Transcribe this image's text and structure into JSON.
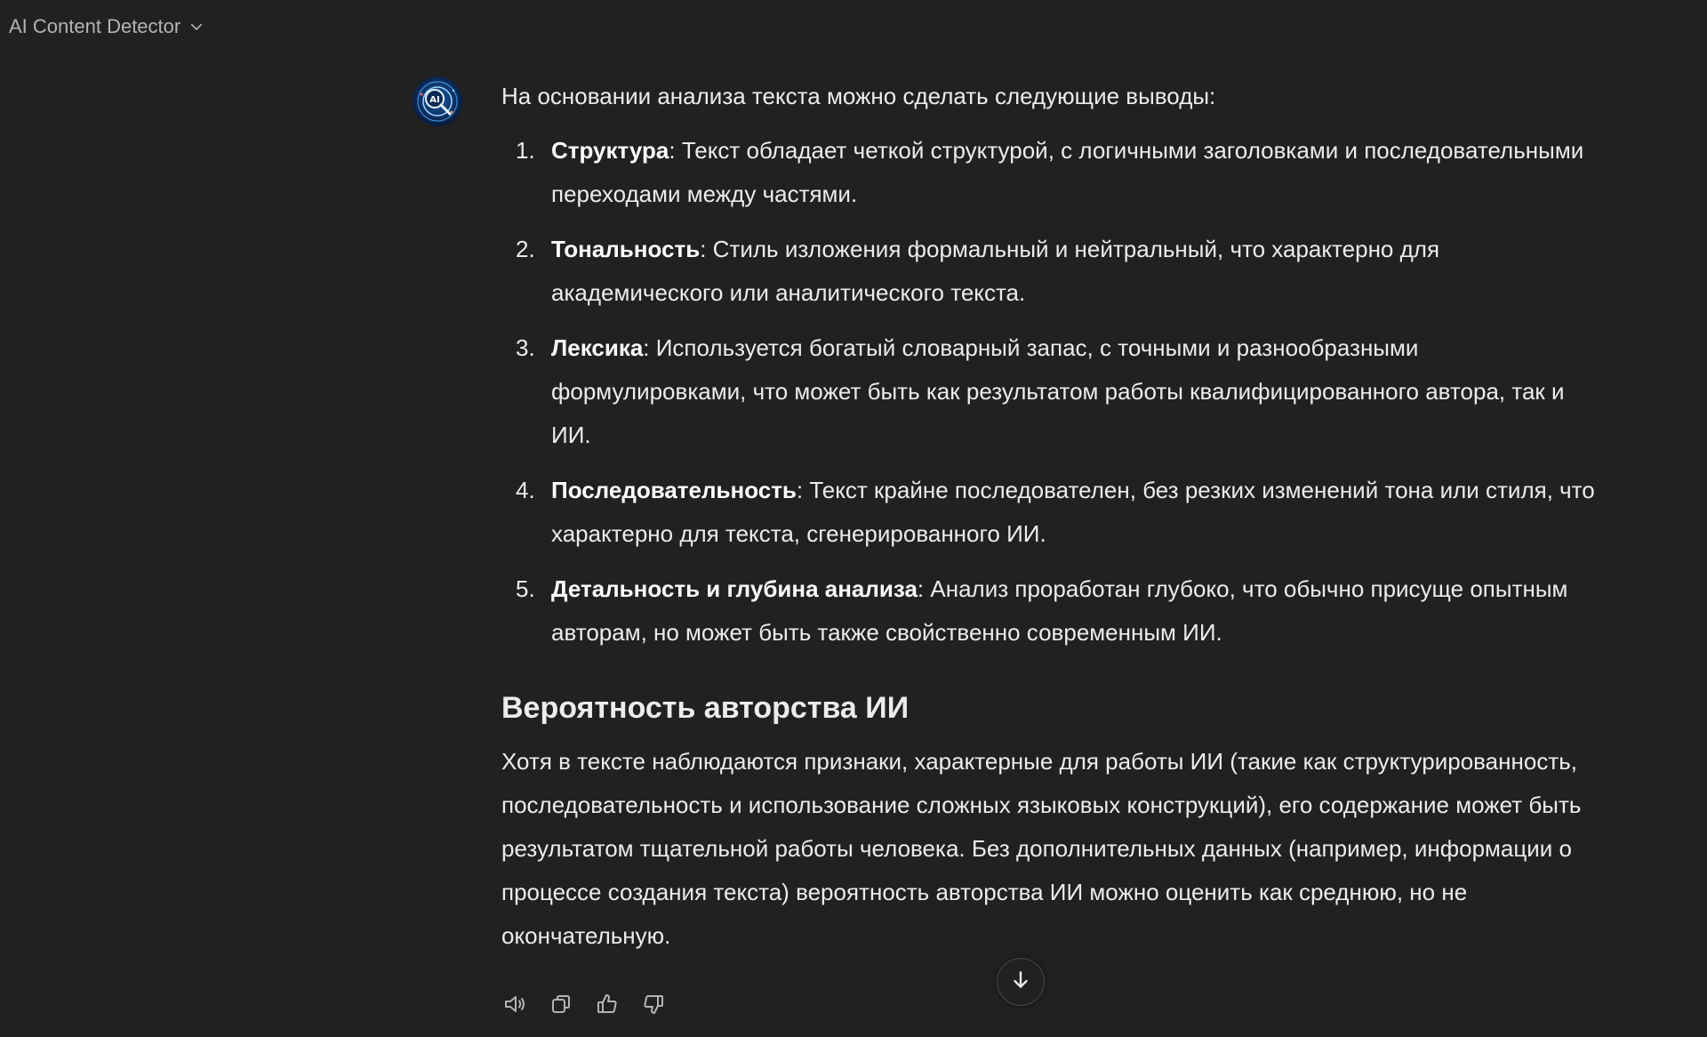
{
  "header": {
    "model_name": "AI Content Detector"
  },
  "message": {
    "avatar_text": "AI",
    "intro": "На основании анализа текста можно сделать следующие выводы:",
    "points": [
      {
        "number": "1.",
        "title": "Структура",
        "text": ": Текст обладает четкой структурой, с логичными заголовками и последовательными переходами между частями."
      },
      {
        "number": "2.",
        "title": "Тональность",
        "text": ": Стиль изложения формальный и нейтральный, что характерно для академического или аналитического текста."
      },
      {
        "number": "3.",
        "title": "Лексика",
        "text": ": Используется богатый словарный запас, с точными и разнообразными формулировками, что может быть как результатом работы квалифицированного автора, так и ИИ."
      },
      {
        "number": "4.",
        "title": "Последовательность",
        "text": ": Текст крайне последователен, без резких изменений тона или стиля, что характерно для текста, сгенерированного ИИ."
      },
      {
        "number": "5.",
        "title": "Детальность и глубина анализа",
        "text": ": Анализ проработан глубоко, что обычно присуще опытным авторам, но может быть также свойственно современным ИИ."
      }
    ],
    "section_title": "Вероятность авторства ИИ",
    "conclusion": "Хотя в тексте наблюдаются признаки, характерные для работы ИИ (такие как структурированность, последовательность и использование сложных языковых конструкций), его содержание может быть результатом тщательной работы человека. Без дополнительных данных (например, информации о процессе создания текста) вероятность авторства ИИ можно оценить как среднюю, но не окончательную."
  },
  "actions": {
    "icons": [
      "speaker-icon",
      "copy-icon",
      "thumbs-up-icon",
      "thumbs-down-icon"
    ]
  },
  "scroll": {
    "icon": "arrow-down-icon"
  },
  "colors": {
    "background": "#212121",
    "text": "#ececec",
    "muted": "#b4b4b4"
  }
}
